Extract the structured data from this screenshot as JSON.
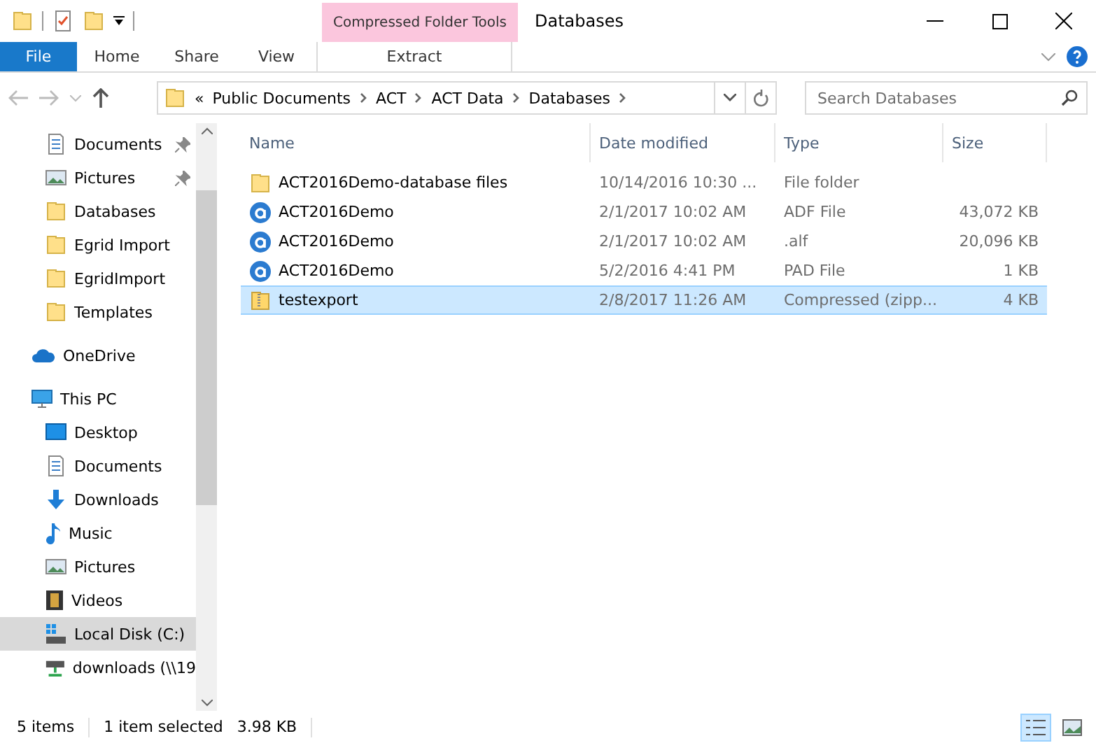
{
  "window": {
    "title": "Databases"
  },
  "ribbon": {
    "context_group": "Compressed Folder Tools",
    "tabs": [
      {
        "label": "File",
        "kind": "file"
      },
      {
        "label": "Home",
        "kind": "tab"
      },
      {
        "label": "Share",
        "kind": "tab"
      },
      {
        "label": "View",
        "kind": "tab"
      },
      {
        "label": "Extract",
        "kind": "context"
      }
    ]
  },
  "address_bar": {
    "overflow": "«",
    "crumbs": [
      "Public Documents",
      "ACT",
      "ACT Data",
      "Databases"
    ]
  },
  "search": {
    "placeholder": "Search Databases"
  },
  "nav": {
    "pinned_items": [
      {
        "label": "Documents",
        "kind": "document",
        "pinned": true,
        "selected": false
      },
      {
        "label": "Pictures",
        "kind": "pictures",
        "pinned": true,
        "selected": false
      },
      {
        "label": "Databases",
        "kind": "folder",
        "pinned": false,
        "selected": false
      },
      {
        "label": "Egrid Import",
        "kind": "folder",
        "pinned": false,
        "selected": false
      },
      {
        "label": "EgridImport",
        "kind": "folder",
        "pinned": false,
        "selected": false
      },
      {
        "label": "Templates",
        "kind": "folder",
        "pinned": false,
        "selected": false
      }
    ],
    "roots": [
      {
        "label": "OneDrive",
        "kind": "cloud",
        "selected": false
      },
      {
        "label": "This PC",
        "kind": "pc",
        "selected": false,
        "children": [
          {
            "label": "Desktop",
            "kind": "desktop",
            "selected": false
          },
          {
            "label": "Documents",
            "kind": "document",
            "selected": false
          },
          {
            "label": "Downloads",
            "kind": "download",
            "selected": false
          },
          {
            "label": "Music",
            "kind": "music",
            "selected": false
          },
          {
            "label": "Pictures",
            "kind": "pictures",
            "selected": false
          },
          {
            "label": "Videos",
            "kind": "video",
            "selected": false
          },
          {
            "label": "Local Disk (C:)",
            "kind": "disk",
            "selected": true
          },
          {
            "label": "downloads (\\\\19",
            "kind": "netdrive",
            "selected": false
          }
        ]
      }
    ]
  },
  "table": {
    "columns": [
      "Name",
      "Date modified",
      "Type",
      "Size"
    ],
    "rows": [
      {
        "kind": "folder",
        "name": "ACT2016Demo-database files",
        "date": "10/14/2016 10:30 ...",
        "type": "File folder",
        "selected": false
      },
      {
        "kind": "act",
        "name": "ACT2016Demo",
        "date": "2/1/2017 10:02 AM",
        "type": "ADF File",
        "size": "43,072 KB",
        "selected": false
      },
      {
        "kind": "act",
        "name": "ACT2016Demo",
        "date": "2/1/2017 10:02 AM",
        "type": ".alf",
        "size": "20,096 KB",
        "selected": false
      },
      {
        "kind": "act",
        "name": "ACT2016Demo",
        "date": "5/2/2016 4:41 PM",
        "type": "PAD File",
        "size": "1 KB",
        "selected": false
      },
      {
        "kind": "zip",
        "name": "testexport",
        "date": "2/8/2017 11:26 AM",
        "type": "Compressed (zipp...",
        "size": "4 KB",
        "selected": true
      }
    ]
  },
  "status_bar": {
    "item_count": "5 items",
    "selection": "1 item selected",
    "selection_size": "3.98 KB",
    "view_buttons": [
      {
        "kind": "details",
        "selected": true
      },
      {
        "kind": "large-icons",
        "selected": false
      }
    ]
  }
}
